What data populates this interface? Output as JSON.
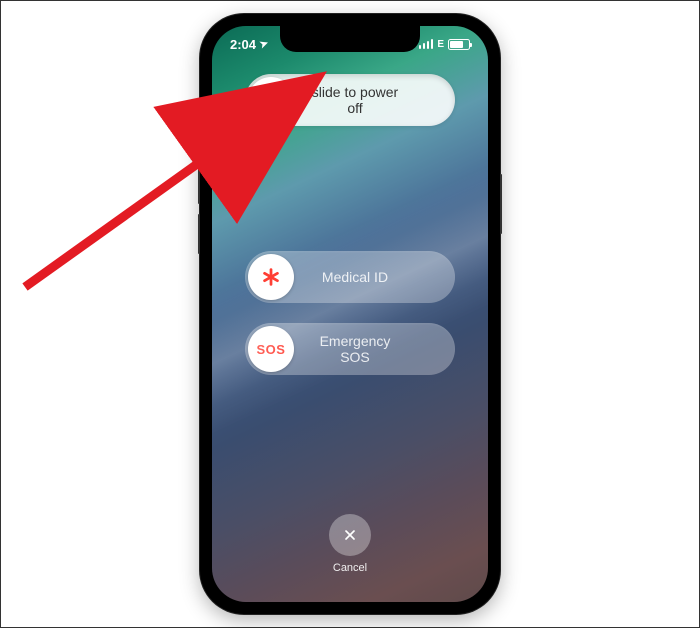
{
  "status": {
    "time": "2:04",
    "location_arrow": "➤"
  },
  "sliders": {
    "power": {
      "label": "slide to power off"
    },
    "medical": {
      "label": "Medical ID",
      "knob_text": "✱"
    },
    "sos": {
      "label": "Emergency SOS",
      "knob_text": "SOS"
    }
  },
  "cancel": {
    "label": "Cancel"
  },
  "colors": {
    "red": "#ff3b30"
  }
}
